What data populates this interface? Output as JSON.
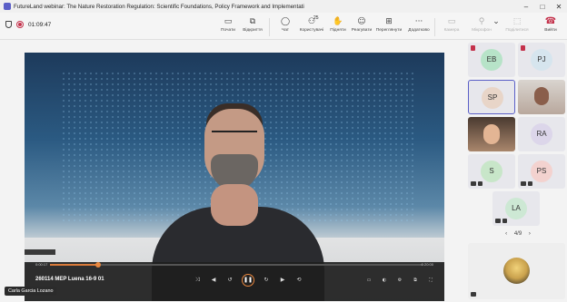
{
  "window": {
    "title": "FutureLand webinar: The Nature Restoration Regulation: Scientific Foundations, Policy Framework and Implementation Ch...",
    "controls": [
      "–",
      "□",
      "✕"
    ]
  },
  "meeting": {
    "timer": "01:09:47"
  },
  "toolbar": {
    "buttons": [
      {
        "label": "Почати",
        "icon": "whiteboard-icon"
      },
      {
        "label": "Відкриття",
        "icon": "share-icon"
      },
      {
        "label": "Чат",
        "icon": "chat-icon"
      },
      {
        "label": "Користувачі",
        "icon": "people-icon",
        "count": "25"
      },
      {
        "label": "Підняти",
        "icon": "raise-hand-icon"
      },
      {
        "label": "Реагувати",
        "icon": "react-icon"
      },
      {
        "label": "Переглянути",
        "icon": "view-icon"
      },
      {
        "label": "Додатково",
        "icon": "more-icon"
      },
      {
        "label": "Камера",
        "icon": "camera-icon",
        "disabled": true
      },
      {
        "label": "Мікрофон",
        "icon": "mic-icon",
        "disabled": true
      },
      {
        "label": "Поділитися",
        "icon": "share-screen-icon",
        "disabled": true
      },
      {
        "label": "Вийти",
        "icon": "leave-icon"
      }
    ]
  },
  "video": {
    "time_elapsed": "0:00:17",
    "time_total": "0:20:00",
    "progress": 0.13,
    "title": "260114 MEP Luena 16-9 01"
  },
  "presenter": {
    "name": "Carla Garcia Lozano"
  },
  "participants": [
    {
      "initials": "EB",
      "color": "#b7e3c8"
    },
    {
      "initials": "PJ",
      "color": "#d6e5ee"
    },
    {
      "initials": "SP",
      "color": "#e8d5c8",
      "active": true
    },
    {
      "initials": "",
      "camera": true
    },
    {
      "initials": "",
      "camera": true
    },
    {
      "initials": "RA",
      "color": "#dcd6ea"
    },
    {
      "initials": "S",
      "color": "#c8e6c9"
    },
    {
      "initials": "PS",
      "color": "#f3d2cf"
    },
    {
      "initials": "LA",
      "color": "#cde8d4"
    }
  ],
  "pager": {
    "text": "4/9"
  }
}
